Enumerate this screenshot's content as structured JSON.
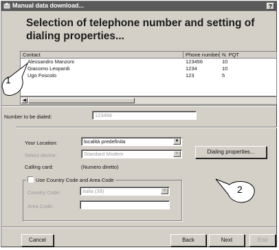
{
  "window": {
    "title": "Manual data download...",
    "help_label": "?"
  },
  "heading": "Selection of telephone number and setting of dialing properties...",
  "contacts": {
    "columns": [
      "Contact",
      "Phone number",
      "N. PQT"
    ],
    "rows": [
      {
        "contact": "Alessandro Manzoni",
        "phone": "123456",
        "pqt": "10"
      },
      {
        "contact": "Giacomo Leopardi",
        "phone": "1234",
        "pqt": "10"
      },
      {
        "contact": "Ugo Foscolo",
        "phone": "123",
        "pqt": "5"
      }
    ],
    "scroll_left_glyph": "◀"
  },
  "dial": {
    "label": "Number to be dialed:",
    "value": "123456"
  },
  "location": {
    "label": "Your Location:",
    "value": "località predefinita"
  },
  "device": {
    "label": "Select device:",
    "value": "Standard Modem"
  },
  "dialing_properties_button": "Dialing properties...",
  "calling_card": {
    "label": "Calling card:",
    "value": "(Numero diretto)"
  },
  "country_area": {
    "checkbox_label": "Use Country Code and Area Code",
    "checked": false,
    "country_label": "Country Code:",
    "country_value": "Italia (39)",
    "area_label": "Area Code:",
    "area_value": ""
  },
  "callouts": [
    "1",
    "2"
  ],
  "combo_glyph": "▼",
  "buttons": {
    "cancel": "Cancel",
    "back": "Back",
    "next": "Next",
    "end": "End"
  },
  "colors": {
    "dialog_face": "#d4d0c8",
    "titlebar": "#5a5a5a",
    "disabled_text": "#9a9a9a"
  }
}
